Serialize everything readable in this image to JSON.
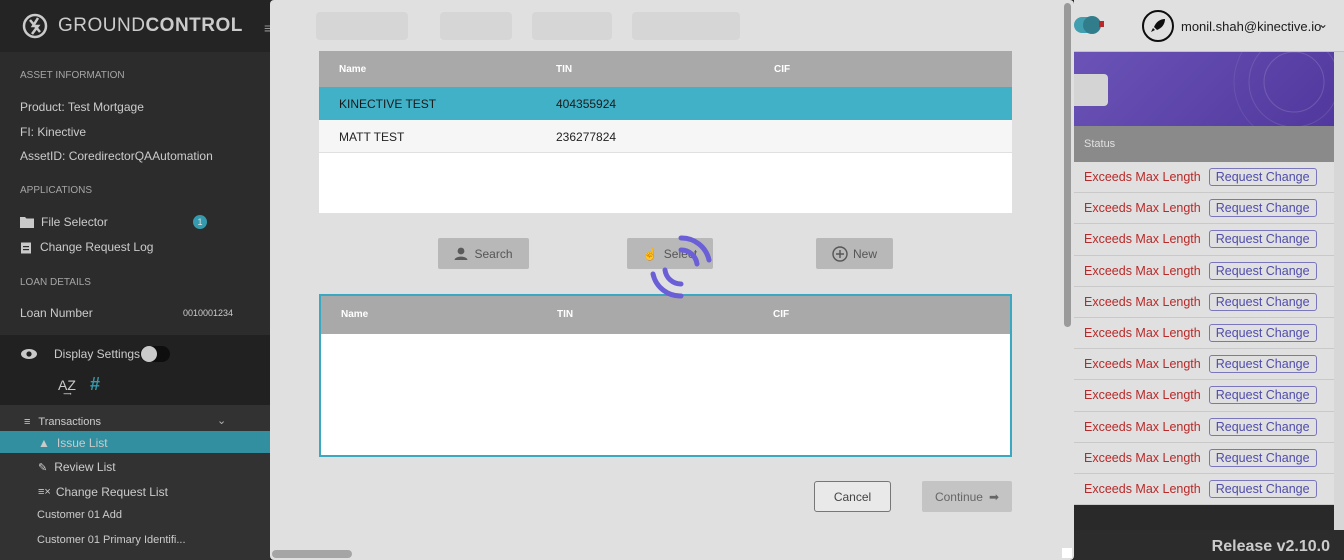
{
  "app": {
    "brand_light": "GROUND",
    "brand_bold": "CONTROL"
  },
  "sidebar": {
    "asset_header": "ASSET INFORMATION",
    "product_label": "Product:",
    "product_value": "Test Mortgage",
    "fi_label": "FI:",
    "fi_value": "Kinective",
    "asset_label": "AssetID:",
    "asset_value": "CoredirectorQAAutomation",
    "applications_header": "APPLICATIONS",
    "file_selector": "File Selector",
    "file_selector_badge": "1",
    "change_request_log": "Change Request Log",
    "loan_header": "LOAN DETAILS",
    "loan_number_label": "Loan Number",
    "loan_number_value": "0010001234",
    "display_settings": "Display Settings",
    "transactions": "Transactions",
    "items": [
      "Issue List",
      "Review List",
      "Change Request List",
      "Customer 01 Add",
      "Customer 01 Primary Identifi..."
    ]
  },
  "header": {
    "user": "monil.shah@kinective.io"
  },
  "status_panel": {
    "header": "Status",
    "rows": [
      {
        "status": "Exceeds Max Length",
        "action": "Request Change"
      },
      {
        "status": "Exceeds Max Length",
        "action": "Request Change"
      },
      {
        "status": "Exceeds Max Length",
        "action": "Request Change"
      },
      {
        "status": "Exceeds Max Length",
        "action": "Request Change"
      },
      {
        "status": "Exceeds Max Length",
        "action": "Request Change"
      },
      {
        "status": "Exceeds Max Length",
        "action": "Request Change"
      },
      {
        "status": "Exceeds Max Length",
        "action": "Request Change"
      },
      {
        "status": "Exceeds Max Length",
        "action": "Request Change"
      },
      {
        "status": "Exceeds Max Length",
        "action": "Request Change"
      },
      {
        "status": "Exceeds Max Length",
        "action": "Request Change"
      },
      {
        "status": "Exceeds Max Length",
        "action": "Request Change"
      }
    ]
  },
  "footer": {
    "release": "Release v2.10.0"
  },
  "modal": {
    "table_top": {
      "headers": [
        "Name",
        "TIN",
        "CIF"
      ],
      "rows": [
        {
          "name": "KINECTIVE TEST",
          "tin": "404355924",
          "cif": ""
        },
        {
          "name": "MATT TEST",
          "tin": "236277824",
          "cif": ""
        }
      ]
    },
    "buttons": {
      "search": "Search",
      "select": "Select",
      "new": "New"
    },
    "table_bottom": {
      "headers": [
        "Name",
        "TIN",
        "CIF"
      ]
    },
    "cancel": "Cancel",
    "continue": "Continue"
  },
  "colors": {
    "accent": "#3aa3b5",
    "error": "#d32f2f",
    "link": "#5a57c7",
    "spinner": "#6a5fd6"
  }
}
